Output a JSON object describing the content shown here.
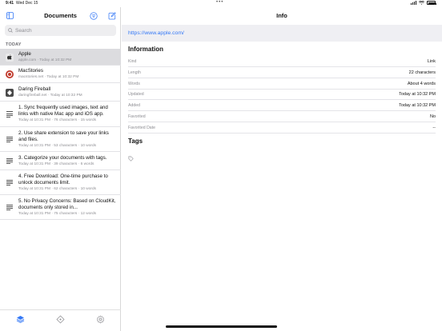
{
  "status": {
    "time": "9:41",
    "date": "Wed Dec 15",
    "dots": "•••"
  },
  "sidebar": {
    "title": "Documents",
    "search_placeholder": "Search",
    "section": "TODAY",
    "items": [
      {
        "title": "Apple",
        "meta": "apple.com · Today at 10:32 PM",
        "icon": "apple-icon",
        "selected": true
      },
      {
        "title": "MacStories",
        "meta": "macstories.net · Today at 10:32 PM",
        "icon": "macstories-icon"
      },
      {
        "title": "Daring Fireball",
        "meta": "daringfireball.net · Today at 10:32 PM",
        "icon": "daring-fireball-icon"
      },
      {
        "title": "1. Sync frequently used images, text and links with native Mac app and iOS app.",
        "meta": "Today at 10:31 PM · 76 characters · 15 words",
        "icon": "text-lines-icon"
      },
      {
        "title": "2. Use share extension to save your links and files.",
        "meta": "Today at 10:31 PM · 53 characters · 10 words",
        "icon": "text-lines-icon"
      },
      {
        "title": "3. Categorize your documents with tags.",
        "meta": "Today at 10:31 PM · 39 characters · 6 words",
        "icon": "text-lines-icon"
      },
      {
        "title": "4. Free Download: One-time purchase to unlock documents limit.",
        "meta": "Today at 10:31 PM · 62 characters · 10 words",
        "icon": "text-lines-icon"
      },
      {
        "title": "5. No Privacy Concerns: Based on CloudKit, documents only stored in...",
        "meta": "Today at 10:31 PM · 75 characters · 12 words",
        "icon": "text-lines-icon"
      }
    ],
    "tabs": [
      "layers-icon",
      "tag-diamond-icon",
      "gear-icon"
    ]
  },
  "detail": {
    "title": "Info",
    "url": "https://www.apple.com/",
    "info_heading": "Information",
    "fields": [
      {
        "key": "Kind",
        "value": "Link"
      },
      {
        "key": "Length",
        "value": "22 characters"
      },
      {
        "key": "Words",
        "value": "About 4 words"
      },
      {
        "key": "Updated",
        "value": "Today at 10:32 PM"
      },
      {
        "key": "Added",
        "value": "Today at 10:32 PM"
      },
      {
        "key": "Favorited",
        "value": "No"
      },
      {
        "key": "Favorited Date",
        "value": "--"
      }
    ],
    "tags_heading": "Tags"
  },
  "colors": {
    "accent": "#3478f6",
    "selected_row": "#dcdcdf",
    "url_bar": "#efeff3"
  }
}
